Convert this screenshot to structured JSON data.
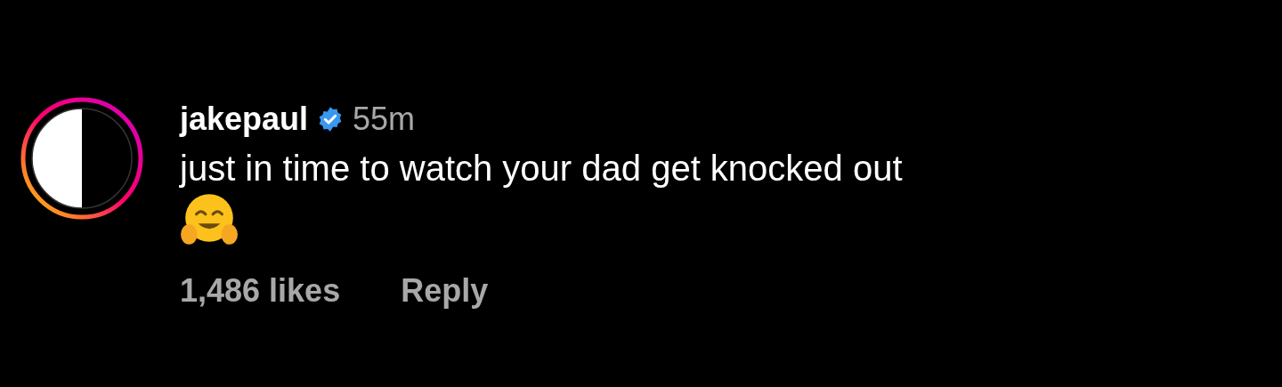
{
  "comment": {
    "has_story": true,
    "username": "jakepaul",
    "verified": true,
    "time": "55m",
    "text": "just in time to watch your dad get knocked out",
    "likes": "1,486 likes",
    "reply": "Reply"
  }
}
